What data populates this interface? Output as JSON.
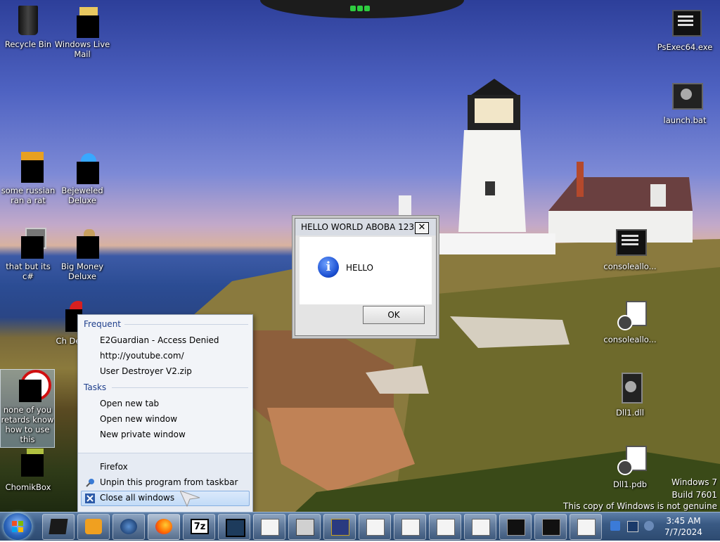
{
  "desktop": {
    "icons": [
      {
        "label": "Recycle Bin"
      },
      {
        "label": "Windows Live Mail"
      },
      {
        "label": "some russian ran a rat"
      },
      {
        "label": "Bejeweled Deluxe"
      },
      {
        "label": "that but its c#"
      },
      {
        "label": "Big Money Deluxe"
      },
      {
        "label": "Ch De"
      },
      {
        "label": "none of you retards know how to use this"
      },
      {
        "label": "ChomikBox"
      },
      {
        "label": "PsExec64.exe"
      },
      {
        "label": "launch.bat"
      },
      {
        "label": "consoleallo..."
      },
      {
        "label": "consoleallo..."
      },
      {
        "label": "Dll1.dll"
      },
      {
        "label": "Dll1.pdb"
      }
    ]
  },
  "dialog": {
    "title": "HELLO WORLD ABOBA 123",
    "close": "✕",
    "message": "HELLO",
    "ok": "OK",
    "info_icon": "i"
  },
  "jumplist": {
    "frequent_header": "Frequent",
    "frequent": [
      "E2Guardian - Access Denied",
      "http://youtube.com/",
      "User Destroyer V2.zip"
    ],
    "tasks_header": "Tasks",
    "tasks": [
      "Open new tab",
      "Open new window",
      "New private window"
    ],
    "app_name": "Firefox",
    "unpin": "Unpin this program from taskbar",
    "close_all": "Close all windows"
  },
  "watermark": {
    "line1": "Windows 7",
    "line2": "Build 7601",
    "line3": "This copy of Windows is not genuine"
  },
  "taskbar": {
    "sevenzip_label": "7z",
    "clock_time": "3:45 AM",
    "clock_date": "7/7/2024"
  }
}
